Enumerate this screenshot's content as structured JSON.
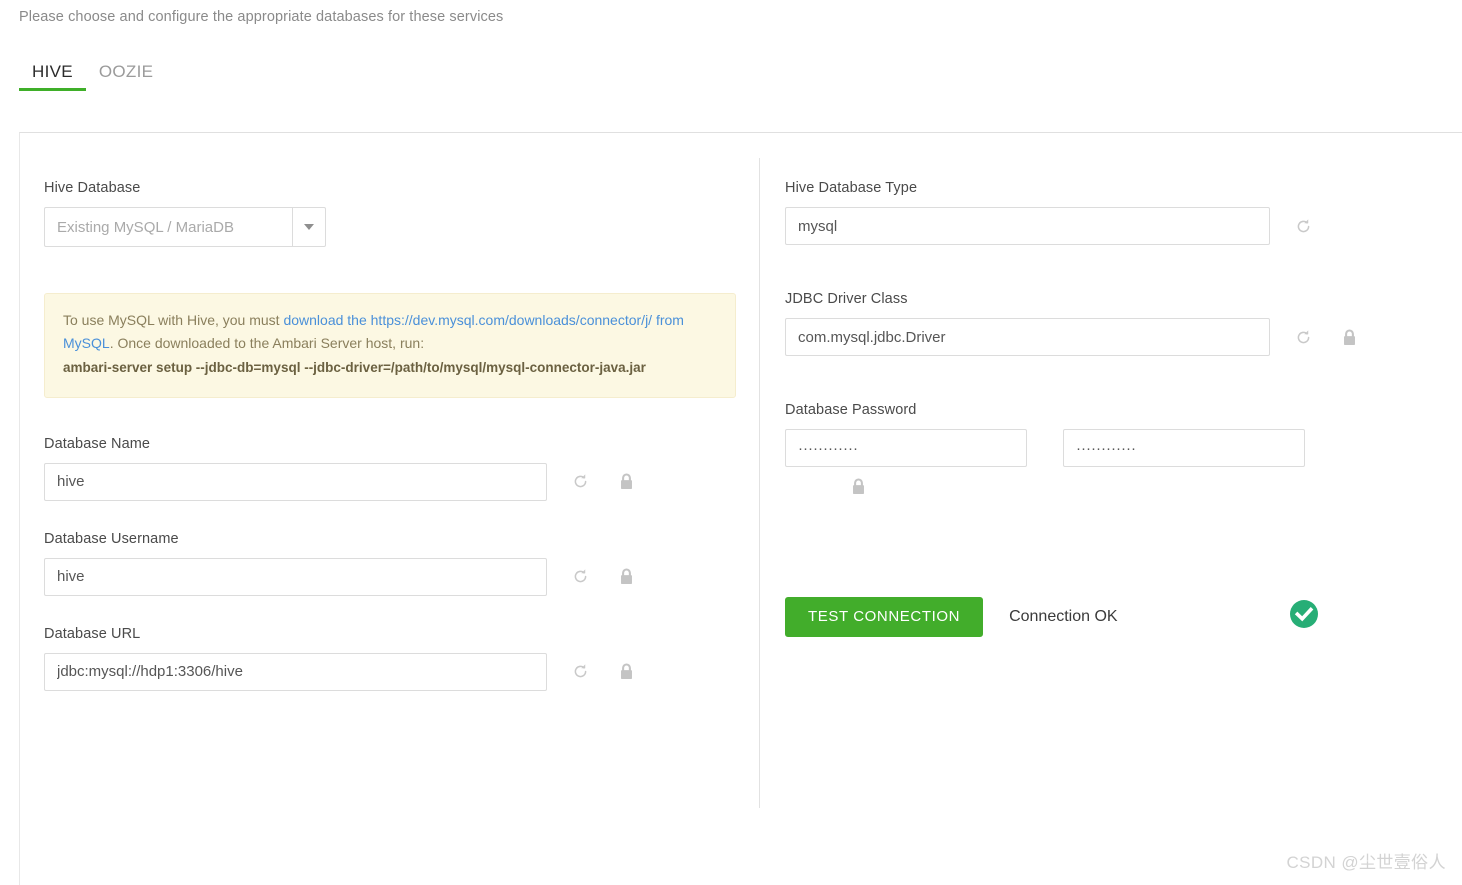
{
  "header": {
    "intro": "Please choose and configure the appropriate databases for these services"
  },
  "tabs": [
    {
      "label": "HIVE",
      "active": true
    },
    {
      "label": "OOZIE",
      "active": false
    }
  ],
  "left_column": {
    "hive_database": {
      "label": "Hive Database",
      "selected": "Existing MySQL / MariaDB",
      "caret_icon": "chevron-down-icon"
    },
    "alert": {
      "text_1": "To use MySQL with Hive, you must ",
      "link_1": "download the",
      "link_2": "https://dev.mysql.com/downloads/connector/j/ from MySQL",
      "text_2": ". Once downloaded to the Ambari Server host, run:",
      "command": "ambari-server setup --jdbc-db=mysql --jdbc-driver=/path/to/mysql/mysql-connector-java.jar"
    },
    "database_name": {
      "label": "Database Name",
      "value": "hive",
      "refresh_icon": "refresh-icon",
      "lock_icon": "lock-icon"
    },
    "database_username": {
      "label": "Database Username",
      "value": "hive",
      "refresh_icon": "refresh-icon",
      "lock_icon": "lock-icon"
    },
    "database_url": {
      "label": "Database URL",
      "value": "jdbc:mysql://hdp1:3306/hive",
      "refresh_icon": "refresh-icon",
      "lock_icon": "lock-icon"
    }
  },
  "right_column": {
    "hive_database_type": {
      "label": "Hive Database Type",
      "value": "mysql",
      "refresh_icon": "refresh-icon"
    },
    "jdbc_driver_class": {
      "label": "JDBC Driver Class",
      "value": "com.mysql.jdbc.Driver",
      "refresh_icon": "refresh-icon",
      "lock_icon": "lock-icon"
    },
    "database_password": {
      "label": "Database Password",
      "value": "············",
      "confirm_value": "············",
      "lock_icon": "lock-icon"
    },
    "test_connection": {
      "button_label": "TEST CONNECTION",
      "status": "Connection OK",
      "status_icon": "check-circle-icon"
    }
  },
  "watermark": "CSDN @尘世壹俗人",
  "colors": {
    "accent_green": "#3faf29",
    "button_green": "#42ad2b",
    "status_green": "#27ae76",
    "link_blue": "#4a90d9",
    "alert_bg": "#fcf8e3"
  }
}
